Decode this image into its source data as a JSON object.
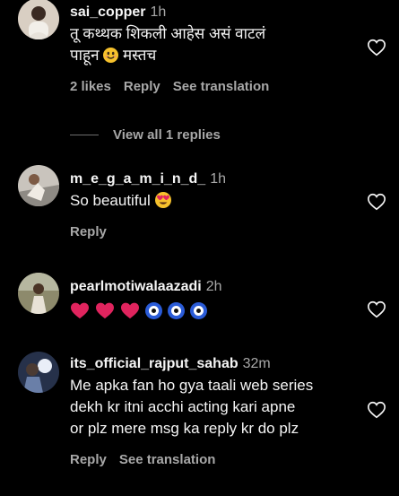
{
  "comments": [
    {
      "username": "sai_copper",
      "time": "1h",
      "text_line1": "तू कथ्थक शिकली आहेस असं वाटलं",
      "text_line2_before": "पाहून",
      "text_line2_after": "मस्तच",
      "likes": "2 likes",
      "reply": "Reply",
      "translate": "See translation"
    },
    {
      "username": "m_e_g_a_m_i_n_d_",
      "time": "1h",
      "text": "So beautiful",
      "reply": "Reply"
    },
    {
      "username": "pearlmotiwalaazadi",
      "time": "2h",
      "emojis": [
        "red-heart",
        "red-heart",
        "red-heart",
        "nazar-amulet",
        "nazar-amulet",
        "nazar-amulet"
      ]
    },
    {
      "username": "its_official_rajput_sahab",
      "time": "32m",
      "text_lines": [
        "Me apka fan ho gya taali web series",
        "dekh kr itni acchi acting kari apne",
        "or plz mere msg ka reply kr do plz"
      ],
      "reply": "Reply",
      "translate": "See translation"
    }
  ],
  "view_replies": "View all 1 replies",
  "colors": {
    "background": "#000000",
    "primary_text": "#f5f5f5",
    "secondary_text": "#a8a8a8",
    "heart_red": "#e0245e",
    "nazar_blue": "#2a5bd7"
  },
  "icons": [
    "heart-outline-icon",
    "smiling-face-emoji",
    "heart-eyes-emoji",
    "red-heart-emoji",
    "nazar-amulet-emoji"
  ]
}
